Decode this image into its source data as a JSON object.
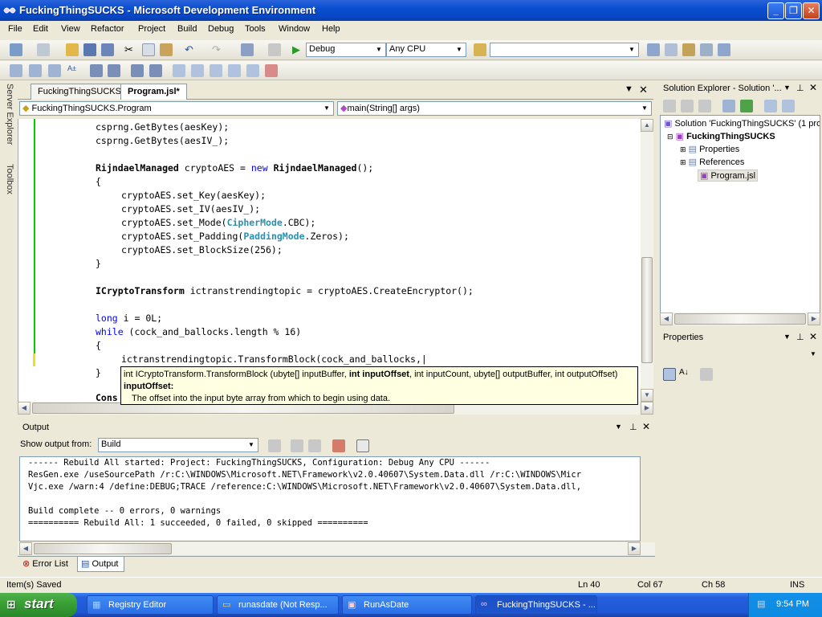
{
  "window": {
    "title": "FuckingThingSUCKS - Microsoft Development Environment"
  },
  "menu": [
    "File",
    "Edit",
    "View",
    "Refactor",
    "Project",
    "Build",
    "Debug",
    "Tools",
    "Window",
    "Help"
  ],
  "toolbar": {
    "config": "Debug",
    "platform": "Any CPU"
  },
  "side_tabs": {
    "server_explorer": "Server Explorer",
    "toolbox": "Toolbox"
  },
  "editor": {
    "tabs": [
      "FuckingThingSUCKS",
      "Program.jsl*"
    ],
    "class_combo": "FuckingThingSUCKS.Program",
    "method_combo": "main(String[] args)"
  },
  "tooltip": {
    "sig_pre": "int ICryptoTransform.TransformBlock (ubyte[] inputBuffer, ",
    "sig_bold": "int inputOffset",
    "sig_post": ", int inputCount, ubyte[] outputBuffer, int outputOffset)",
    "param_name": "inputOffset:",
    "param_desc": "The offset into the input byte array from which to begin using data."
  },
  "output": {
    "title": "Output",
    "show_from_label": "Show output from:",
    "show_from_value": "Build",
    "lines": [
      "------ Rebuild All started: Project: FuckingThingSUCKS, Configuration: Debug Any CPU ------",
      "ResGen.exe /useSourcePath /r:C:\\WINDOWS\\Microsoft.NET\\Framework\\v2.0.40607\\System.Data.dll /r:C:\\WINDOWS\\Micr",
      "Vjc.exe /warn:4 /define:DEBUG;TRACE /reference:C:\\WINDOWS\\Microsoft.NET\\Framework\\v2.0.40607\\System.Data.dll,",
      "",
      "Build complete -- 0 errors, 0 warnings",
      "========== Rebuild All: 1 succeeded, 0 failed, 0 skipped =========="
    ],
    "tabs": [
      "Error List",
      "Output"
    ]
  },
  "solution_explorer": {
    "title": "Solution Explorer - Solution '...",
    "items": [
      "Solution 'FuckingThingSUCKS' (1 pro",
      "FuckingThingSUCKS",
      "Properties",
      "References",
      "Program.jsl"
    ]
  },
  "properties": {
    "title": "Properties"
  },
  "status": {
    "message": "Item(s) Saved",
    "ln": "Ln 40",
    "col": "Col 67",
    "ch": "Ch 58",
    "mode": "INS"
  },
  "taskbar": {
    "start": "start",
    "buttons": [
      "Registry Editor",
      "runasdate (Not Resp...",
      "RunAsDate",
      "FuckingThingSUCKS - ..."
    ],
    "clock": "9:54 PM"
  },
  "colors": {
    "title_bar": "#0a4fd0",
    "keyword": "#0000ff",
    "type": "#2b91af",
    "tooltip_bg": "#ffffe1"
  }
}
